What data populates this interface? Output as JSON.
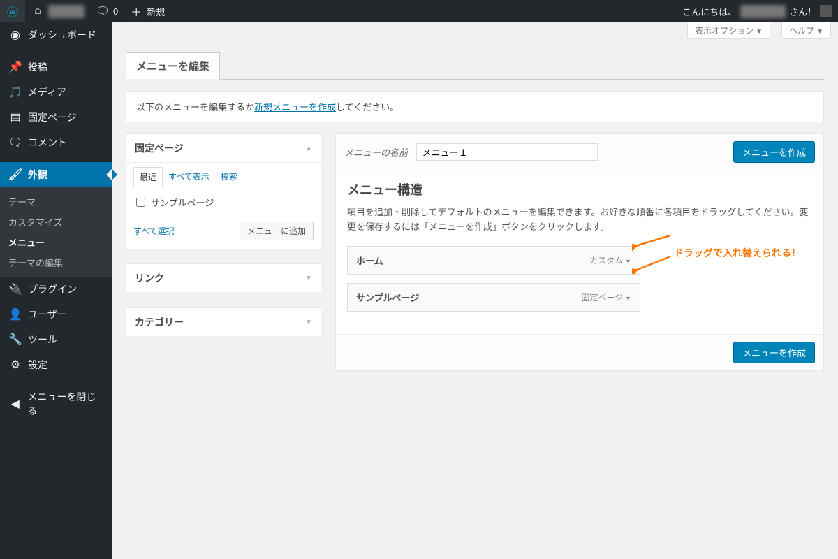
{
  "adminbar": {
    "site_name": "サイト名",
    "comments": "0",
    "new": "新規",
    "howdy_prefix": "こんにちは、",
    "howdy_name": "ユーザー名",
    "howdy_suffix": " さん！"
  },
  "sidebar": {
    "items": [
      {
        "icon": "dashboard",
        "label": "ダッシュボード"
      },
      {
        "icon": "pin",
        "label": "投稿"
      },
      {
        "icon": "media",
        "label": "メディア"
      },
      {
        "icon": "page",
        "label": "固定ページ"
      },
      {
        "icon": "comment",
        "label": "コメント"
      },
      {
        "icon": "appearance",
        "label": "外観"
      },
      {
        "icon": "plugin",
        "label": "プラグイン"
      },
      {
        "icon": "user",
        "label": "ユーザー"
      },
      {
        "icon": "tool",
        "label": "ツール"
      },
      {
        "icon": "settings",
        "label": "設定"
      },
      {
        "icon": "collapse",
        "label": "メニューを閉じる"
      }
    ],
    "submenu": [
      "テーマ",
      "カスタマイズ",
      "メニュー",
      "テーマの編集"
    ]
  },
  "screenmeta": {
    "options": "表示オプション",
    "help": "ヘルプ"
  },
  "tabs": {
    "edit": "メニューを編集"
  },
  "notice": {
    "pre": "以下のメニューを編集するか",
    "link": "新規メニューを作成",
    "post": "してください。"
  },
  "accordion": {
    "pages": {
      "title": "固定ページ",
      "tabs": [
        "最近",
        "すべて表示",
        "検索"
      ],
      "items": [
        "サンプルページ"
      ],
      "select_all": "すべて選択",
      "add_btn": "メニューに追加"
    },
    "links": {
      "title": "リンク"
    },
    "categories": {
      "title": "カテゴリー"
    }
  },
  "menu_edit": {
    "name_label": "メニューの名前",
    "name_value": "メニュー１",
    "create_btn": "メニューを作成",
    "structure_title": "メニュー構造",
    "structure_desc": "項目を追加・削除してデフォルトのメニューを編集できます。お好きな順番に各項目をドラッグしてください。変更を保存するには「メニューを作成」ボタンをクリックします。",
    "items": [
      {
        "title": "ホーム",
        "type": "カスタム"
      },
      {
        "title": "サンプルページ",
        "type": "固定ページ"
      }
    ]
  },
  "annotation": "ドラッグで入れ替えられる！"
}
